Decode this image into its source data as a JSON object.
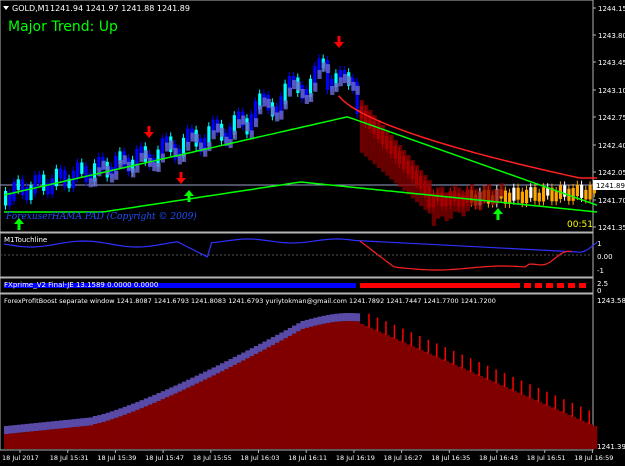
{
  "header": {
    "symbol": "GOLD,M1",
    "ohlc": "1241.94 1241.97 1241.88 1241.89",
    "trend": "Major Trend: Up",
    "watermark": "ForexuserHAMA PAD (Copyright © 2009)",
    "timer": "00:51",
    "current_price": "1241.89"
  },
  "price_axis": [
    "1244.15",
    "1243.80",
    "1243.45",
    "1243.10",
    "1242.75",
    "1242.40",
    "1242.05",
    "1241.70",
    "1241.35"
  ],
  "panels": {
    "m1touchline": {
      "label": "M1Touchline",
      "axis": [
        "0.00",
        "1",
        "-1"
      ]
    },
    "fxprime": {
      "label": "FXprime_V2 Final-JE 13.1589 0.0000 0.0000",
      "axis": [
        "2.5",
        "0"
      ]
    },
    "forexprofitboost": {
      "label": "ForexProfitBoost separate window 1241.8087 1241.6793 1241.8083 1241.6793 yuriytokman@gmail.com 1241.7892 1241.7447 1241.7700 1241.7200",
      "axis": [
        "1243.5853",
        "1241.3934"
      ]
    }
  },
  "time_axis": [
    "18 Jul 2017",
    "18 Jul 15:31",
    "18 Jul 15:39",
    "18 Jul 15:47",
    "18 Jul 15:55",
    "18 Jul 16:03",
    "18 Jul 16:11",
    "18 Jul 16:19",
    "18 Jul 16:27",
    "18 Jul 16:35",
    "18 Jul 16:43",
    "18 Jul 16:51",
    "18 Jul 16:59"
  ],
  "colors": {
    "background": "#000000",
    "bull": "#0000ff",
    "bull_light": "#00ffff",
    "bear": "#ff0000",
    "orange": "#ffa500",
    "ma_red": "#ff2020",
    "ma_green": "#00ff00",
    "trend_text": "#00ff00",
    "boost_dark": "#800000",
    "boost_purple": "#483d8b"
  },
  "icons": [
    "menu-triangle-icon",
    "up-arrow-icon",
    "down-arrow-icon"
  ]
}
